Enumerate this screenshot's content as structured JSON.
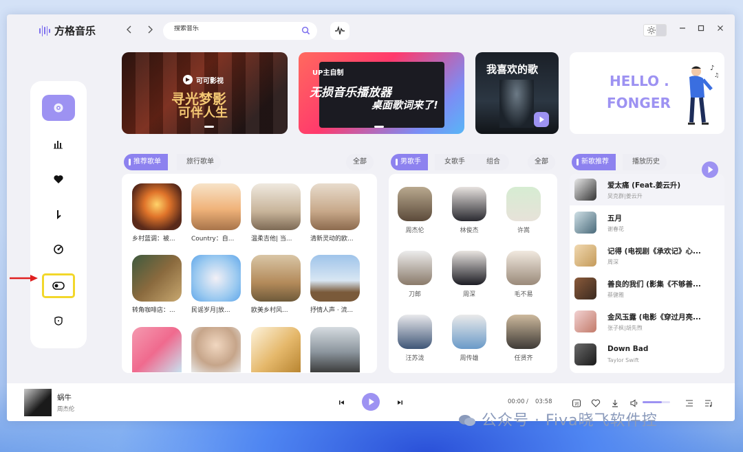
{
  "app": {
    "name": "方格音乐"
  },
  "search": {
    "placeholder": "搜索音乐"
  },
  "banners": [
    {
      "brand": "可可影视",
      "line1": "寻光梦影",
      "line2": "可伴人生"
    },
    {
      "tag": "UP主自制",
      "line1": "无损音乐播放器",
      "line2": "桌面歌词来了!"
    },
    {
      "text": "我喜欢的歌"
    },
    {
      "line1": "HELLO .",
      "line2": "FONGER"
    }
  ],
  "playlists": {
    "tabs": [
      "推荐歌单",
      "旅行歌单"
    ],
    "all": "全部",
    "items": [
      {
        "title": "乡村蓝调：被..."
      },
      {
        "title": "Country：自..."
      },
      {
        "title": "温柔吉他| 当..."
      },
      {
        "title": "清新灵动的欧..."
      },
      {
        "title": "转角咖啡店：..."
      },
      {
        "title": "民谣岁月|放..."
      },
      {
        "title": "欧美乡村风..."
      },
      {
        "title": "抒情人声 · 流..."
      },
      {
        "title": ""
      },
      {
        "title": ""
      },
      {
        "title": ""
      },
      {
        "title": ""
      }
    ]
  },
  "singers": {
    "tabs": [
      "男歌手",
      "女歌手",
      "组合"
    ],
    "all": "全部",
    "items": [
      {
        "name": "周杰伦"
      },
      {
        "name": "林俊杰"
      },
      {
        "name": "许嵩"
      },
      {
        "name": "刀郎"
      },
      {
        "name": "周深"
      },
      {
        "name": "毛不易"
      },
      {
        "name": "汪苏泷"
      },
      {
        "name": "周传雄"
      },
      {
        "name": "任贤齐"
      }
    ]
  },
  "songs": {
    "tabs": [
      "新歌推荐",
      "播放历史"
    ],
    "items": [
      {
        "title": "爱太痛 (Feat.姜云升)",
        "artist": "吴克群|姜云升"
      },
      {
        "title": "五月",
        "artist": "谢春花"
      },
      {
        "title": "记得 (电视剧《承欢记》心...",
        "artist": "周深"
      },
      {
        "title": "善良的我们 (影集《不够善...",
        "artist": "蔡健雅"
      },
      {
        "title": "金风玉露 (电影《穿过月亮...",
        "artist": "张子枫|胡先煦"
      },
      {
        "title": "Down Bad",
        "artist": "Taylor Swift"
      }
    ]
  },
  "player": {
    "title": "蜗牛",
    "artist": "周杰伦",
    "current": "00:00",
    "sep": "/",
    "total": "03:58",
    "volume": 0.7
  },
  "watermark": "公众号 · Fiva晓飞软件控",
  "colors": {
    "accent": "#9d92f2",
    "accent_dark": "#8d82ef",
    "highlight": "#f2d72a",
    "arrow": "#e02020"
  }
}
